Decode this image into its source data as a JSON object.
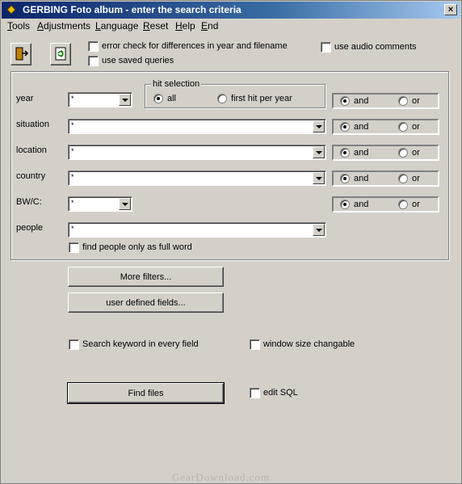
{
  "window": {
    "title": "GERBING Foto album - enter the search criteria",
    "close_glyph": "×"
  },
  "menu": [
    "Tools",
    "Adjustments",
    "Language",
    "Reset",
    "Help",
    "End"
  ],
  "toolbar": {
    "exit_icon": "exit-door-icon",
    "refresh_icon": "refresh-icon"
  },
  "options_top": {
    "error_check": "error check for differences in year and filename",
    "saved_queries": "use saved queries",
    "audio_comments": "use audio comments"
  },
  "hit_selection": {
    "label": "hit selection",
    "all": "all",
    "first_hit": "first hit per year",
    "selected": "all"
  },
  "fields": [
    {
      "label": "year",
      "value": "*",
      "connector": "and"
    },
    {
      "label": "situation",
      "value": "*",
      "connector": "and"
    },
    {
      "label": "location",
      "value": "*",
      "connector": "and"
    },
    {
      "label": "country",
      "value": "*",
      "connector": "and"
    },
    {
      "label": "BW/C:",
      "value": "*",
      "connector": "and"
    },
    {
      "label": "people",
      "value": "*"
    }
  ],
  "connectors": {
    "and": "and",
    "or": "or"
  },
  "find_people_full_word": "find people only as full word",
  "buttons": {
    "more_filters": "More filters...",
    "user_defined": "user defined fields...",
    "find_files": "Find files"
  },
  "options_bottom": {
    "search_every_field": "Search keyword in every field",
    "window_size": "window size changable",
    "edit_sql": "edit SQL"
  },
  "watermark": "GearDownload.com"
}
